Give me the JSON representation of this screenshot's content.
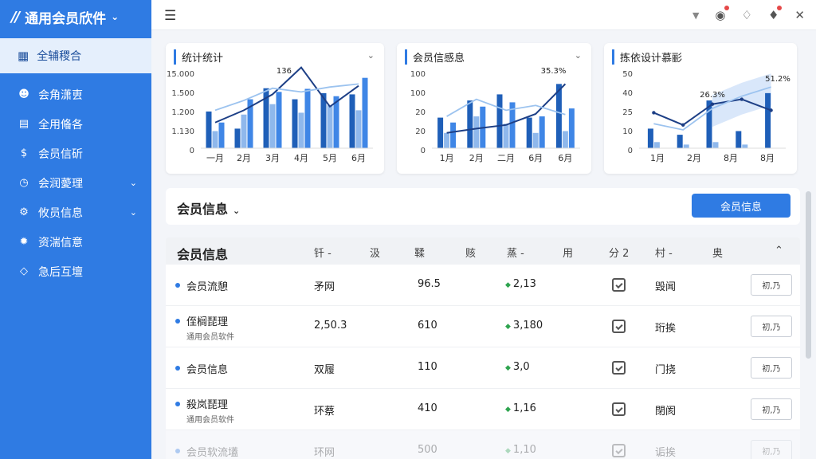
{
  "app": {
    "title": "通用会员欣件"
  },
  "sidebar": {
    "active": {
      "label": "全辅稷合",
      "icon": "grid-icon"
    },
    "items": [
      {
        "label": "会角潇叀",
        "icon": "users-icon",
        "has_arrow": false
      },
      {
        "label": "全用偹各",
        "icon": "card-icon",
        "has_arrow": false
      },
      {
        "label": "会员信斫",
        "icon": "coin-icon",
        "has_arrow": false
      },
      {
        "label": "会润薆理",
        "icon": "clock-icon",
        "has_arrow": true
      },
      {
        "label": "攸员信息",
        "icon": "gear-icon",
        "has_arrow": true
      },
      {
        "label": "资湍信意",
        "icon": "settings-icon",
        "has_arrow": false
      },
      {
        "label": "急后互壇",
        "icon": "diamond-icon",
        "has_arrow": false
      }
    ]
  },
  "topbar": {
    "icons": [
      "caret-down-icon",
      "target-icon",
      "tag-icon",
      "bell-icon",
      "close-icon"
    ]
  },
  "cards": [
    {
      "title": "统计统计"
    },
    {
      "title": "会员信感息"
    },
    {
      "title": "拣依设计慕彨"
    }
  ],
  "chart_data": [
    {
      "type": "bar",
      "title": "统计统计",
      "categories": [
        "一月",
        "2月",
        "3月",
        "4月",
        "5月",
        "6月"
      ],
      "ytick_labels": [
        "15.000",
        "1.500",
        "1.200",
        "1.130",
        "0"
      ],
      "annotation": "136",
      "series": [
        {
          "values": [
            0.6,
            0.32,
            0.98,
            0.8,
            0.9,
            0.88
          ]
        },
        {
          "values": [
            0.28,
            0.55,
            0.72,
            0.58,
            0.7,
            0.62
          ]
        },
        {
          "values": [
            0.42,
            0.8,
            0.92,
            0.97,
            0.85,
            1.15
          ]
        }
      ],
      "line_series": [
        {
          "values": [
            0.42,
            0.62,
            0.88,
            1.32,
            0.68,
            1.02
          ]
        },
        {
          "values": [
            0.62,
            0.78,
            0.98,
            0.92,
            1.0,
            1.05
          ]
        }
      ]
    },
    {
      "type": "bar",
      "title": "会员信感息",
      "categories": [
        "1月",
        "2月",
        "二月",
        "6月",
        "6月"
      ],
      "ytick_labels": [
        "100",
        "100",
        "20",
        "20",
        "0"
      ],
      "annotation": "35.3%",
      "series": [
        {
          "values": [
            0.5,
            0.78,
            0.88,
            0.5,
            1.05
          ]
        },
        {
          "values": [
            0.25,
            0.52,
            0.4,
            0.25,
            0.28
          ]
        },
        {
          "values": [
            0.42,
            0.68,
            0.75,
            0.52,
            0.65
          ]
        }
      ],
      "line_series": [
        {
          "values": [
            0.25,
            0.32,
            0.38,
            0.56,
            1.05
          ]
        },
        {
          "values": [
            0.52,
            0.8,
            0.62,
            0.7,
            0.55
          ]
        }
      ]
    },
    {
      "type": "bar",
      "title": "拣依设计慕彨",
      "categories": [
        "1月",
        "2月",
        "8月",
        "8月"
      ],
      "ytick_labels": [
        "50",
        "40",
        "25",
        "10",
        "0"
      ],
      "annotations": [
        "26.3%",
        "51.2%"
      ],
      "series": [
        {
          "values": [
            0.32,
            0.22,
            0.78,
            0.28,
            0.9
          ]
        },
        {
          "values": [
            0.1,
            0.06,
            0.1,
            0.06,
            0.0
          ]
        }
      ],
      "line_series": [
        {
          "values": [
            0.58,
            0.38,
            0.72,
            0.8,
            0.62
          ]
        },
        {
          "values": [
            0.4,
            0.3,
            0.65,
            0.85,
            1.0
          ]
        }
      ]
    }
  ],
  "section": {
    "title": "会员信息",
    "button_label": "会员信息"
  },
  "table": {
    "title": "会员信息",
    "headers": [
      "钎 -",
      "汲",
      "鞣",
      "赅",
      "蒸 -",
      "用",
      "分 2",
      "村 -",
      "奥"
    ],
    "rows": [
      {
        "name": "会员流憩",
        "sub": "",
        "c1": "矛网",
        "c2": "96.5",
        "c3": "2,13",
        "c4": "毁闻",
        "btn": "初,乃"
      },
      {
        "name": "侄榈琵理",
        "sub": "通用会员软件",
        "c1": "2,50.3",
        "c2": "610",
        "c3": "3,180",
        "c4": "珩挨",
        "btn": "初,乃"
      },
      {
        "name": "会员信息",
        "sub": "",
        "c1": "双履",
        "c2": "110",
        "c3": "3,0",
        "c4": "门挠",
        "btn": "初,乃"
      },
      {
        "name": "殺岚琵理",
        "sub": "通用会员软件",
        "c1": "环蔡",
        "c2": "410",
        "c3": "1,16",
        "c4": "閉阂",
        "btn": "初,乃"
      },
      {
        "name": "会员软流壒",
        "sub": "",
        "c1": "环网",
        "c2": "500",
        "c3": "1,10",
        "c4": "诟挨",
        "btn": "初,乃"
      }
    ]
  }
}
